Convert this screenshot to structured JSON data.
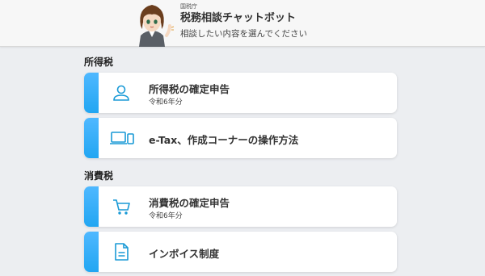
{
  "header": {
    "agency": "国税庁",
    "title": "税務相談チャットボット",
    "subtitle": "相談したい内容を選んでください"
  },
  "sections": [
    {
      "title": "所得税",
      "items": [
        {
          "title": "所得税の確定申告",
          "subtitle": "令和6年分",
          "icon": "person-icon"
        },
        {
          "title": "e-Tax、作成コーナーの操作方法",
          "icon": "devices-icon"
        }
      ]
    },
    {
      "title": "消費税",
      "items": [
        {
          "title": "消費税の確定申告",
          "subtitle": "令和6年分",
          "icon": "cart-icon"
        },
        {
          "title": "インボイス制度",
          "icon": "document-icon"
        }
      ]
    }
  ],
  "colors": {
    "accent": "#2aa9f5",
    "icon": "#1a9ad6",
    "background": "#eceef1"
  }
}
